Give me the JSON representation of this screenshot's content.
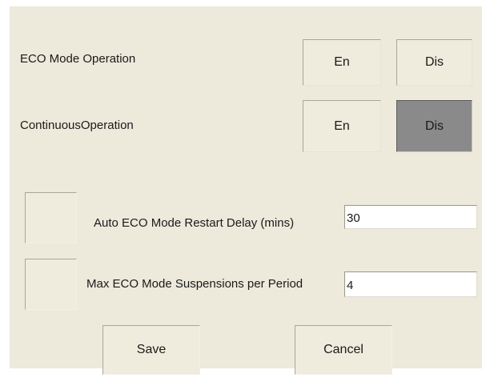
{
  "settings": {
    "eco_mode": {
      "label": "ECO Mode Operation",
      "enable_label": "En",
      "disable_label": "Dis",
      "selected": "none"
    },
    "continuous": {
      "label": "ContinuousOperation",
      "enable_label": "En",
      "disable_label": "Dis",
      "selected": "Dis"
    },
    "restart_delay": {
      "label": "Auto ECO Mode Restart Delay (mins)",
      "value": "30"
    },
    "max_suspensions": {
      "label": "Max ECO Mode Suspensions per Period",
      "value": "4"
    }
  },
  "actions": {
    "save_label": "Save",
    "cancel_label": "Cancel"
  },
  "colors": {
    "panel_bg": "#ede9db",
    "pressed_button": "#8a8a8a"
  }
}
